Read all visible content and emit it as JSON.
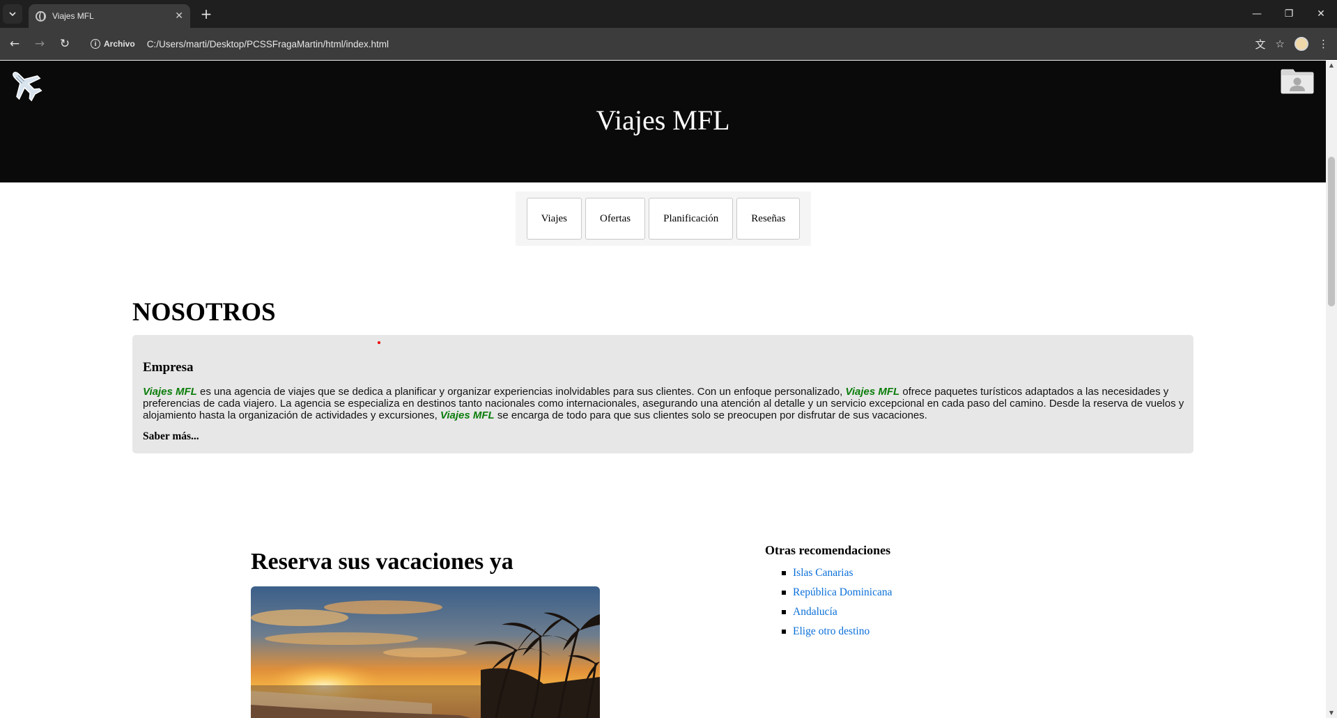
{
  "browser": {
    "tab_title": "Viajes MFL",
    "tab_close": "✕",
    "new_tab": "+",
    "win_minimize": "—",
    "win_restore": "❐",
    "win_close": "✕",
    "back": "←",
    "forward": "→",
    "reload": "↻",
    "origin_label": "Archivo",
    "url": "C:/Users/marti/Desktop/PCSSFragaMartin/html/index.html",
    "translate_icon": "文",
    "bookmark_icon": "☆",
    "menu_icon": "⋮"
  },
  "header": {
    "title": "Viajes MFL"
  },
  "nav": {
    "items": [
      "Viajes",
      "Ofertas",
      "Planificación",
      "Reseñas"
    ]
  },
  "about": {
    "title": "NOSOTROS",
    "heading": "Empresa",
    "brand": "Viajes MFL",
    "text_1": " es una agencia de viajes que se dedica a planificar y organizar experiencias inolvidables para sus clientes. Con un enfoque personalizado, ",
    "text_2": " ofrece paquetes turísticos adaptados a las necesidades y preferencias de cada viajero. La agencia se especializa en destinos tanto nacionales como internacionales, asegurando una atención al detalle y un servicio excepcional en cada paso del camino. Desde la reserva de vuelos y alojamiento hasta la organización de actividades y excursiones, ",
    "text_3": " se encarga de todo para que sus clientes solo se preocupen por disfrutar de sus vacaciones.",
    "more_link": "Saber más..."
  },
  "booking": {
    "title": "Reserva sus vacaciones ya"
  },
  "recommendations": {
    "title": "Otras recomendaciones",
    "items": [
      "Islas Canarias",
      "República Dominicana",
      "Andalucía",
      "Elige otro destino"
    ]
  },
  "colors": {
    "brand_green": "#0b7d0b",
    "link_blue": "#0a6fd9",
    "header_bg": "#0a0a0a",
    "card_bg": "#e7e7e7"
  }
}
